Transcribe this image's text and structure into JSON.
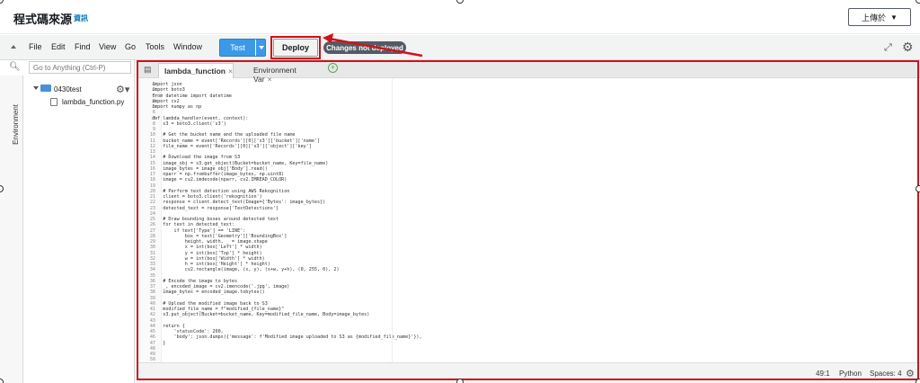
{
  "header": {
    "title": "程式碼來源",
    "info_link": "資訊",
    "upload_button": "上傳於",
    "upload_caret": "▼"
  },
  "toolbar": {
    "menu": [
      "File",
      "Edit",
      "Find",
      "View",
      "Go",
      "Tools",
      "Window"
    ],
    "test_label": "Test",
    "deploy_label": "Deploy",
    "status_pill": "Changes not deployed"
  },
  "sidebar": {
    "environment_tab": "Environment",
    "search_placeholder": "Go to Anything (Ctrl-P)",
    "folder_name": "0430test",
    "file_name": "lambda_function.py"
  },
  "editor": {
    "tabs": [
      {
        "label": "lambda_function",
        "close": "×"
      },
      {
        "label": "Environment Var",
        "close": "×"
      }
    ],
    "add_tab": "+",
    "line_numbers": "1\n2\n3\n4\n5\n6\n7\n8\n9\n10\n11\n12\n13\n14\n15\n16\n17\n18\n19\n20\n21\n22\n23\n24\n25\n26\n27\n28\n29\n30\n31\n32\n33\n34\n35\n36\n37\n38\n39\n40\n41\n42\n43\n44\n45\n46\n47\n48\n49\n50",
    "code": "import json\nimport boto3\nfrom datetime import datetime\nimport cv2\nimport numpy as np\n\ndef lambda_handler(event, context):\n    s3 = boto3.client('s3')\n\n    # Get the bucket name and the uploaded file name\n    bucket_name = event['Records'][0]['s3']['bucket']['name']\n    file_name = event['Records'][0]['s3']['object']['key']\n\n    # Download the image from S3\n    image_obj = s3.get_object(Bucket=bucket_name, Key=file_name)\n    image_bytes = image_obj['Body'].read()\n    nparr = np.frombuffer(image_bytes, np.uint8)\n    image = cv2.imdecode(nparr, cv2.IMREAD_COLOR)\n\n    # Perform text detection using AWS Rekognition\n    client = boto3.client('rekognition')\n    response = client.detect_text(Image={'Bytes': image_bytes})\n    detected_text = response['TextDetections']\n\n    # Draw bounding boxes around detected text\n    for text in detected_text:\n        if text['Type'] == 'LINE':\n            box = text['Geometry']['BoundingBox']\n            height, width, _ = image.shape\n            x = int(box['Left'] * width)\n            y = int(box['Top'] * height)\n            w = int(box['Width'] * width)\n            h = int(box['Height'] * height)\n            cv2.rectangle(image, (x, y), (x+w, y+h), (0, 255, 0), 2)\n\n    # Encode the image to bytes\n    _, encoded_image = cv2.imencode('.jpg', image)\n    image_bytes = encoded_image.tobytes()\n\n    # Upload the modified image back to S3\n    modified_file_name = f\"modified_{file_name}\"\n    s3.put_object(Bucket=bucket_name, Key=modified_file_name, Body=image_bytes)\n\n    return {\n        'statusCode': 200,\n        'body': json.dumps({'message': f'Modified image uploaded to S3 as {modified_file_name}'}),\n    }\n\n",
    "status": {
      "cursor": "49:1",
      "language": "Python",
      "spaces": "Spaces: 4"
    }
  },
  "icons": [
    "collapse-caret-icon",
    "fullscreen-icon",
    "gear-icon",
    "search-icon",
    "folder-icon",
    "python-file-icon",
    "close-icon",
    "add-tab-icon"
  ],
  "colors": {
    "accent_blue": "#3b9ae8",
    "highlight_red": "#d0121b",
    "pill_gray": "#545b64",
    "link_blue": "#0073bb"
  }
}
